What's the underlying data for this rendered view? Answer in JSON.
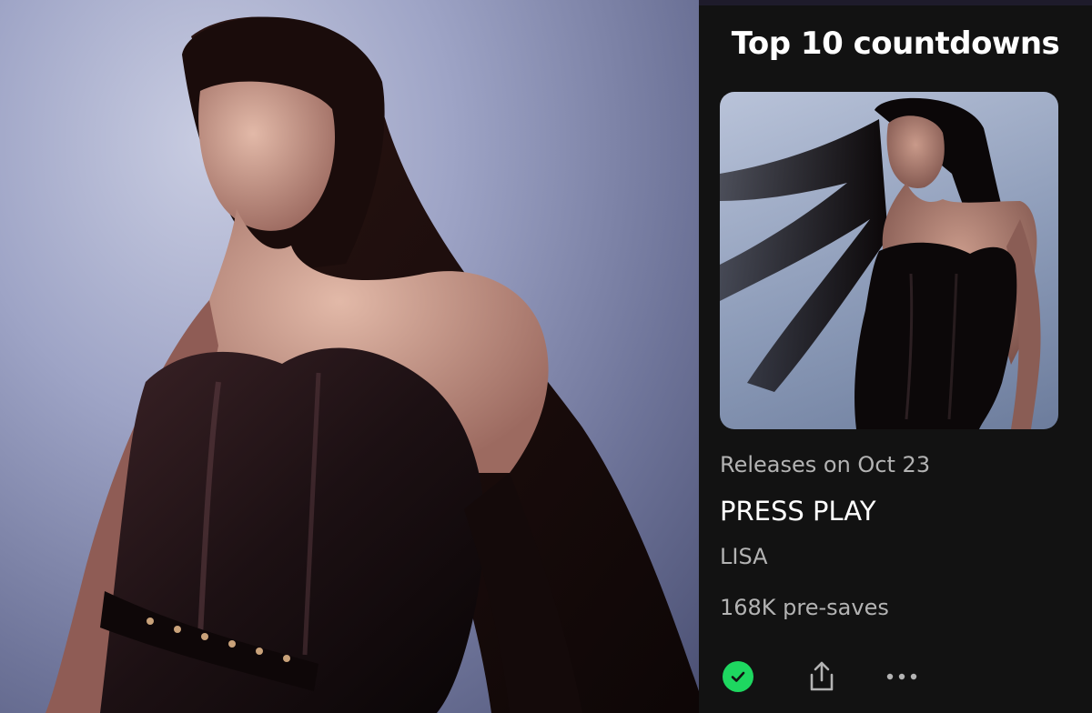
{
  "panel": {
    "title": "Top 10 countdowns"
  },
  "release": {
    "date_text": "Releases on Oct 23",
    "title": "PRESS PLAY",
    "artist": "LISA",
    "presaves": "168K pre-saves",
    "saved": true
  },
  "icons": {
    "saved": "check-circle-icon",
    "share": "share-icon",
    "more": "more-horizontal-icon"
  },
  "colors": {
    "background": "#121212",
    "accent": "#1ed760",
    "text_primary": "#ffffff",
    "text_secondary": "#b3b3b3"
  }
}
